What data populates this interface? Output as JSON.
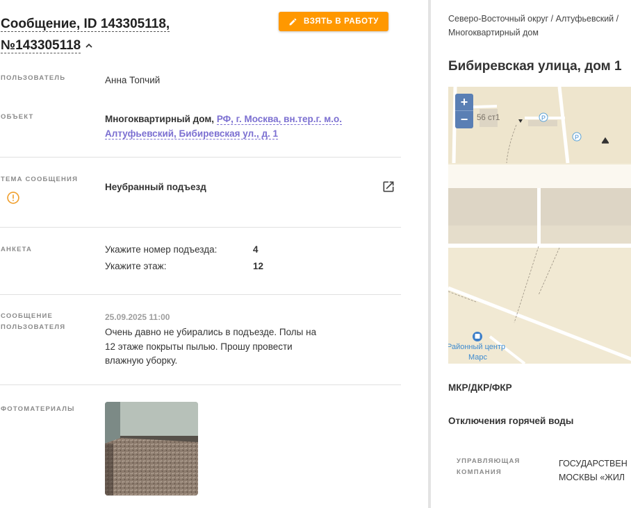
{
  "header": {
    "title_line1": "Сообщение, ID 143305118,",
    "title_line2": "№143305118",
    "take_button": "ВЗЯТЬ В РАБОТУ"
  },
  "fields": {
    "user_label": "ПОЛЬЗОВАТЕЛЬ",
    "user_value": "Анна Топчий",
    "object_label": "ОБЪЕКТ",
    "object_type": "Многоквартирный дом,",
    "object_address_line1": "РФ, г. Москва, вн.тер.г. м.о.",
    "object_address_line2": "Алтуфьевский, Бибиревская ул., д. 1",
    "topic_label": "ТЕМА СООБЩЕНИЯ",
    "topic_value": "Неубранный подъезд",
    "survey_label": "АНКЕТА",
    "survey": [
      {
        "q": "Укажите номер подъезда:",
        "a": "4"
      },
      {
        "q": "Укажите этаж:",
        "a": "12"
      }
    ],
    "message_label_line1": "СООБЩЕНИЕ",
    "message_label_line2": "ПОЛЬЗОВАТЕЛЯ",
    "message_date": "25.09.2025 11:00",
    "message_text": "Очень давно не убирались в подъезде. Полы на 12 этаже покрыты пылью. Прошу провести влажную уборку.",
    "photos_label": "ФОТОМАТЕРИАЛЫ"
  },
  "side": {
    "breadcrumb": "Северо-Восточный округ / Алтуфьевский / Многоквартирный дом",
    "address": "Бибиревская улица, дом 1",
    "map": {
      "zoom_in": "+",
      "zoom_out": "−",
      "building_label": "56 ст1",
      "parking_label": "P",
      "place_line1": "Районный центр",
      "place_line2": "Марс"
    },
    "section_mkr": "МКР/ДКР/ФКР",
    "section_hot_water": "Отключения горячей воды",
    "uk_label_line1": "УПРАВЛЯЮЩАЯ",
    "uk_label_line2": "КОМПАНИЯ",
    "uk_value_line1": "ГОСУДАРСТВЕН",
    "uk_value_line2": "МОСКВЫ «ЖИЛ"
  },
  "colors": {
    "accent": "#ff9800",
    "link": "#7b6fd1",
    "map_zoom": "#5a7fb4"
  }
}
